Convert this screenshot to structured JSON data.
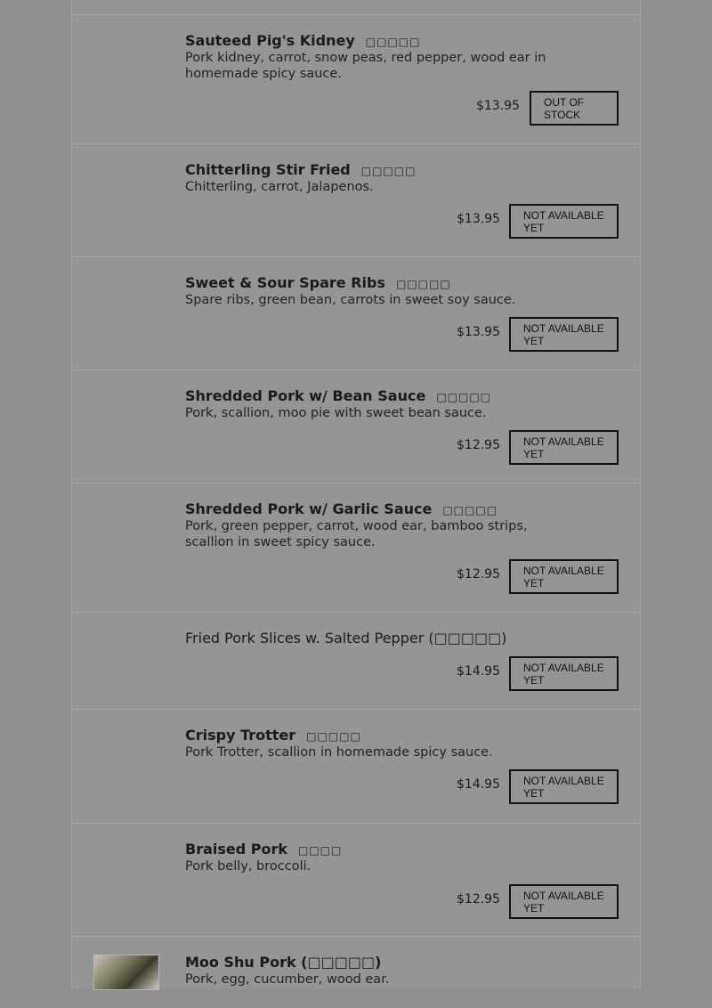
{
  "menu": {
    "items": [
      {
        "name": "Sauteed Pig's Kidney",
        "cn": "□□□□□",
        "desc": "Pork kidney, carrot, snow peas, red pepper, wood ear in homemade spicy sauce.",
        "price": "$13.95",
        "status": "OUT OF STOCK"
      },
      {
        "name": "Chitterling Stir Fried",
        "cn": "□□□□□",
        "desc": "Chitterling, carrot, Jalapenos.",
        "price": "$13.95",
        "status": "NOT AVAILABLE YET"
      },
      {
        "name": "Sweet & Sour Spare Ribs",
        "cn": "□□□□□",
        "desc": "Spare ribs, green bean, carrots in sweet soy sauce.",
        "price": "$13.95",
        "status": "NOT AVAILABLE YET"
      },
      {
        "name": "Shredded Pork w/ Bean Sauce",
        "cn": "□□□□□",
        "desc": "Pork, scallion, moo pie with sweet bean sauce.",
        "price": "$12.95",
        "status": "NOT AVAILABLE YET"
      },
      {
        "name": "Shredded Pork w/ Garlic Sauce",
        "cn": "□□□□□",
        "desc": "Pork, green pepper, carrot, wood ear, bamboo strips, scallion in sweet spicy sauce.",
        "price": "$12.95",
        "status": "NOT AVAILABLE YET"
      },
      {
        "name": "Fried Pork Slices w. Salted Pepper (□□□□□)",
        "cn": "",
        "desc": "",
        "price": "$14.95",
        "status": "NOT AVAILABLE YET"
      },
      {
        "name": "Crispy Trotter",
        "cn": "□□□□□",
        "desc": "Pork Trotter, scallion in homemade spicy sauce.",
        "price": "$14.95",
        "status": "NOT AVAILABLE YET"
      },
      {
        "name": "Braised Pork",
        "cn": "□□□□",
        "desc": "Pork belly, broccoli.",
        "price": "$12.95",
        "status": "NOT AVAILABLE YET"
      },
      {
        "name": "Moo Shu Pork (□□□□□)",
        "cn": "",
        "desc": "Pork, egg, cucumber, wood ear.",
        "price": "",
        "status": ""
      }
    ]
  }
}
